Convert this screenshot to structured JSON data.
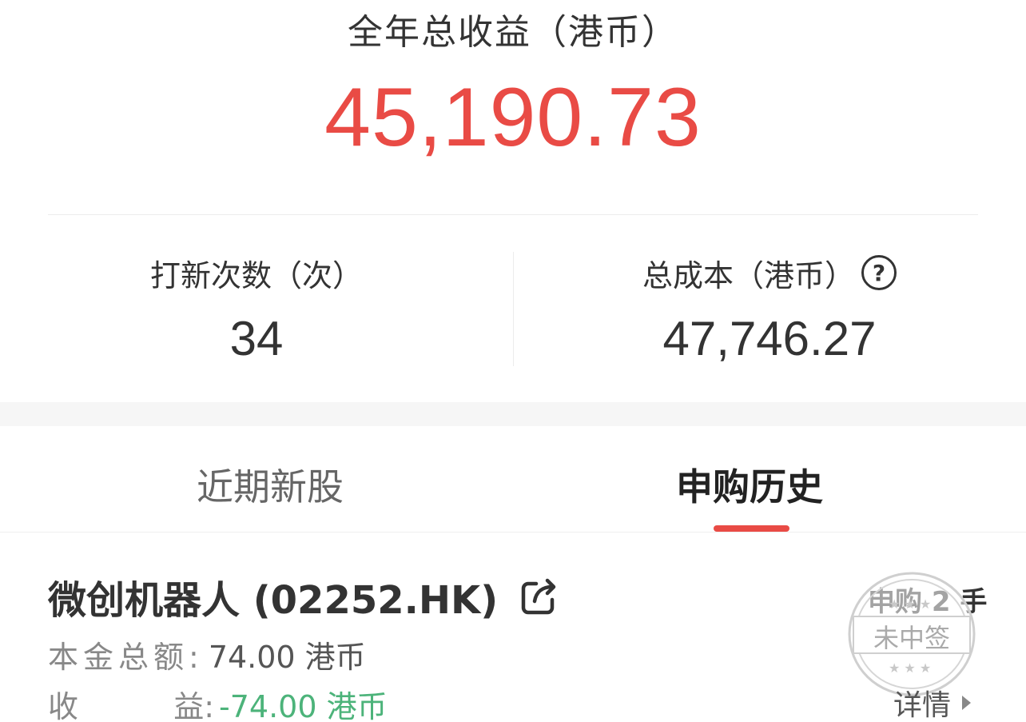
{
  "summary": {
    "total_label": "全年总收益（港币）",
    "total_value": "45,190.73",
    "ipo_count_label": "打新次数（次）",
    "ipo_count_value": "34",
    "total_cost_label": "总成本（港币）",
    "total_cost_value": "47,746.27"
  },
  "tabs": {
    "recent": "近期新股",
    "history": "申购历史",
    "active": "history"
  },
  "record": {
    "name": "微创机器人 (02252.HK)",
    "quantity": "申购 2 手",
    "stamp_text": "未中签",
    "principal_label": "本金总额:",
    "principal_value": "74.00 港币",
    "profit_label_a": "收",
    "profit_label_b": "益:",
    "profit_value": "-74.00 港币",
    "detail_label": "详情"
  },
  "colors": {
    "accent_red": "#e94b45",
    "loss_green": "#4cb37a"
  },
  "icons": {
    "help": "question-circle-icon",
    "share": "share-icon",
    "arrow": "triangle-right-icon"
  }
}
